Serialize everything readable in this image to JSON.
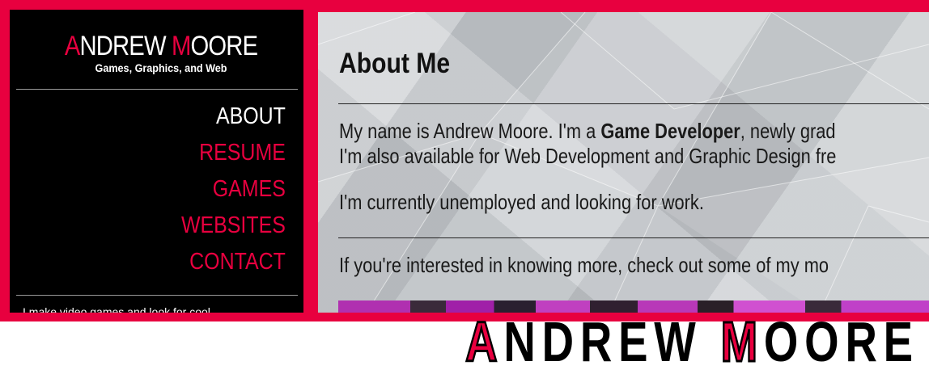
{
  "brand": {
    "first_initial": "A",
    "first_rest": "NDREW ",
    "last_initial": "M",
    "last_rest": "OORE",
    "tagline": "Games, Graphics, and Web"
  },
  "nav": {
    "items": [
      {
        "label": "ABOUT",
        "active": true
      },
      {
        "label": "RESUME",
        "active": false
      },
      {
        "label": "GAMES",
        "active": false
      },
      {
        "label": "WEBSITES",
        "active": false
      },
      {
        "label": "CONTACT",
        "active": false
      }
    ]
  },
  "sidebar_footer": {
    "text": "I make video games and look for cool..."
  },
  "main": {
    "heading": "About Me",
    "intro_prefix": "My name is Andrew Moore. I'm a ",
    "intro_bold": "Game Developer",
    "intro_suffix": ", newly grad",
    "intro_line2": "I'm also available for Web Development and Graphic Design fre",
    "status": "I'm currently unemployed and looking for work.",
    "more": "If you're interested in knowing more, check out some of my mo"
  },
  "footer_banner": {
    "first_initial": "A",
    "first_rest": "NDREW ",
    "last_initial": "M",
    "last_rest": "OORE"
  },
  "colors": {
    "accent": "#e8003f",
    "sidebar_bg": "#000000",
    "content_bg": "#c2c6ca"
  }
}
